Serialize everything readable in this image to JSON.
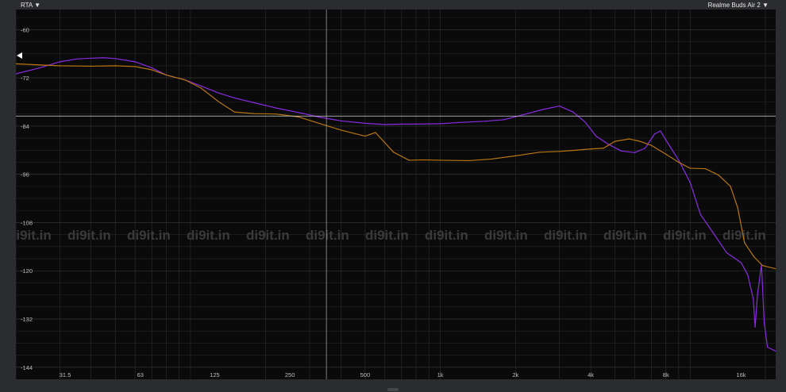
{
  "header": {
    "rta_label": "RTA",
    "device_label": "Realme Buds Air 2",
    "dropdown_glyph": "▼"
  },
  "watermark": {
    "text": "di9it.in"
  },
  "colors": {
    "background": "#0a0a0a",
    "grid": "#2e2e2e",
    "series_purple": "#8a2be2",
    "series_orange": "#b87512"
  },
  "chart_data": {
    "type": "line",
    "x_scale": "log",
    "xlim": [
      20,
      22000
    ],
    "ylim": [
      -147,
      -55
    ],
    "x_ticks": [
      31.5,
      63,
      125,
      250,
      500,
      1000,
      2000,
      4000,
      8000,
      16000
    ],
    "x_tick_labels": [
      "31.5",
      "63",
      "125",
      "250",
      "500",
      "1k",
      "2k",
      "4k",
      "8k",
      "16k"
    ],
    "y_ticks": [
      -60,
      -72,
      -84,
      -96,
      -108,
      -120,
      -132,
      -144
    ],
    "y_tick_labels": [
      "-60",
      "-72",
      "-84",
      "-96",
      "-108",
      "-120",
      "-132",
      "-144"
    ],
    "cursor": {
      "x": 350,
      "y": -81.5
    },
    "grid": true,
    "series": [
      {
        "color": "#8a2be2",
        "points": [
          [
            20,
            -71
          ],
          [
            25,
            -69.5
          ],
          [
            30,
            -68
          ],
          [
            35,
            -67.3
          ],
          [
            40,
            -67.1
          ],
          [
            45,
            -67
          ],
          [
            50,
            -67.2
          ],
          [
            60,
            -68
          ],
          [
            70,
            -69.5
          ],
          [
            80,
            -71.3
          ],
          [
            95,
            -72.5
          ],
          [
            110,
            -74
          ],
          [
            130,
            -75.8
          ],
          [
            150,
            -77
          ],
          [
            180,
            -78.2
          ],
          [
            220,
            -79.5
          ],
          [
            270,
            -80.6
          ],
          [
            330,
            -81.8
          ],
          [
            400,
            -82.7
          ],
          [
            500,
            -83.3
          ],
          [
            600,
            -83.6
          ],
          [
            700,
            -83.5
          ],
          [
            800,
            -83.5
          ],
          [
            1000,
            -83.4
          ],
          [
            1200,
            -83.1
          ],
          [
            1500,
            -82.8
          ],
          [
            1800,
            -82.4
          ],
          [
            2200,
            -81
          ],
          [
            2600,
            -79.8
          ],
          [
            3000,
            -79
          ],
          [
            3400,
            -80.5
          ],
          [
            3800,
            -83
          ],
          [
            4200,
            -86.5
          ],
          [
            4700,
            -88.5
          ],
          [
            5300,
            -90.2
          ],
          [
            6000,
            -90.6
          ],
          [
            6600,
            -89.5
          ],
          [
            7200,
            -86
          ],
          [
            7600,
            -85.2
          ],
          [
            8000,
            -87.5
          ],
          [
            9000,
            -92.5
          ],
          [
            10000,
            -98
          ],
          [
            11000,
            -106
          ],
          [
            12500,
            -111
          ],
          [
            14000,
            -115.5
          ],
          [
            16000,
            -118
          ],
          [
            17000,
            -121
          ],
          [
            17900,
            -127
          ],
          [
            18200,
            -134
          ],
          [
            18600,
            -126
          ],
          [
            19300,
            -118.5
          ],
          [
            19800,
            -133
          ],
          [
            20400,
            -139
          ],
          [
            22000,
            -140
          ]
        ]
      },
      {
        "color": "#b87512",
        "points": [
          [
            20,
            -68.5
          ],
          [
            25,
            -68.8
          ],
          [
            30,
            -69
          ],
          [
            40,
            -69.1
          ],
          [
            50,
            -69
          ],
          [
            60,
            -69.2
          ],
          [
            70,
            -70
          ],
          [
            80,
            -71.3
          ],
          [
            95,
            -72.5
          ],
          [
            110,
            -74.5
          ],
          [
            130,
            -78
          ],
          [
            150,
            -80.5
          ],
          [
            180,
            -80.9
          ],
          [
            220,
            -81
          ],
          [
            270,
            -81.7
          ],
          [
            330,
            -83.4
          ],
          [
            400,
            -85
          ],
          [
            500,
            -86.5
          ],
          [
            550,
            -85.6
          ],
          [
            650,
            -90.5
          ],
          [
            750,
            -92.5
          ],
          [
            850,
            -92.4
          ],
          [
            1000,
            -92.5
          ],
          [
            1300,
            -92.6
          ],
          [
            1600,
            -92.2
          ],
          [
            2000,
            -91.4
          ],
          [
            2500,
            -90.5
          ],
          [
            3000,
            -90.3
          ],
          [
            3500,
            -90
          ],
          [
            4000,
            -89.7
          ],
          [
            4500,
            -89.5
          ],
          [
            5000,
            -87.8
          ],
          [
            5700,
            -87.2
          ],
          [
            6300,
            -87.8
          ],
          [
            7000,
            -88.8
          ],
          [
            8000,
            -91
          ],
          [
            9000,
            -93
          ],
          [
            10000,
            -94.5
          ],
          [
            11500,
            -94.6
          ],
          [
            13000,
            -96.2
          ],
          [
            14500,
            -99
          ],
          [
            15500,
            -104.3
          ],
          [
            16500,
            -113
          ],
          [
            18000,
            -116.5
          ],
          [
            19500,
            -118.7
          ],
          [
            22000,
            -119.5
          ]
        ]
      }
    ]
  }
}
